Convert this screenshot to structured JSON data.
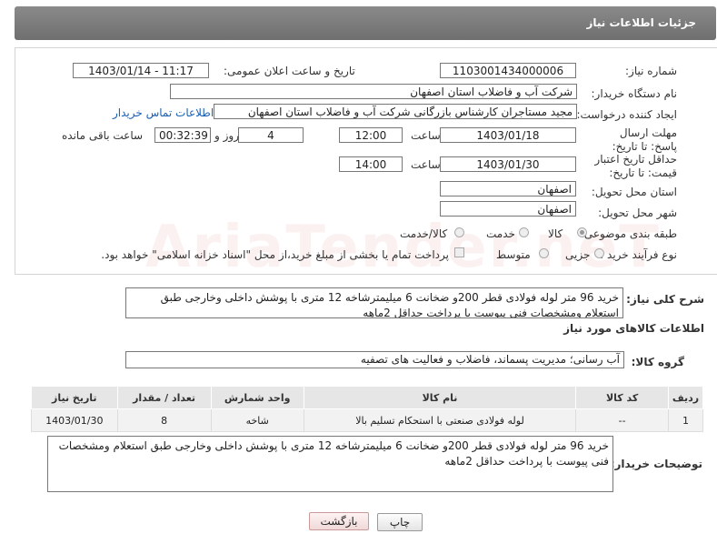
{
  "header": {
    "title": "جزئیات اطلاعات نیاز"
  },
  "form": {
    "need_number_label": "شماره نیاز:",
    "need_number": "1103001434000006",
    "announce_label": "تاریخ و ساعت اعلان عمومی:",
    "announce_value": "1403/01/14 - 11:17",
    "buyer_org_label": "نام دستگاه خریدار:",
    "buyer_org": "شرکت آب و فاضلاب استان اصفهان",
    "creator_label": "ایجاد کننده درخواست:",
    "creator": "مجید مستاجران کارشناس بازرگانی شرکت آب و فاضلاب استان اصفهان",
    "contact_link": "اطلاعات تماس خریدار",
    "deadline_label": "مهلت ارسال پاسخ: تا تاریخ:",
    "deadline_date": "1403/01/18",
    "time_label": "ساعت",
    "deadline_time": "12:00",
    "days_value": "4",
    "days_label": "روز و",
    "remaining_value": "00:32:39",
    "remaining_label": "ساعت باقی مانده",
    "validity_label": "حداقل تاریخ اعتبار قیمت: تا تاریخ:",
    "validity_date": "1403/01/30",
    "validity_time": "14:00",
    "province_label": "استان محل تحویل:",
    "province": "اصفهان",
    "city_label": "شهر محل تحویل:",
    "city": "اصفهان",
    "category_label": "طبقه بندی موضوعی:",
    "category_options": [
      "کالا",
      "خدمت",
      "کالا/خدمت"
    ],
    "category_selected": "کالا",
    "process_label": "نوع فرآیند خرید :",
    "process_options": [
      "جزیی",
      "متوسط"
    ],
    "payment_note": "پرداخت تمام یا بخشی از مبلغ خرید،از محل \"اسناد خزانه اسلامی\" خواهد بود."
  },
  "summary": {
    "label": "شرح کلی نیاز:",
    "text": "خرید 96 متر لوله فولادی قطر 200و ضخانت 6 میلیمترشاخه 12 متری با پوشش داخلی وخارجی طبق استعلام ومشخصات فنی پیوست با پرداخت حداقل 2ماهه"
  },
  "goods": {
    "section_title": "اطلاعات کالاهای مورد نیاز",
    "group_label": "گروه کالا:",
    "group_value": "آب رسانی؛ مدیریت پسماند، فاضلاب و فعالیت های تصفیه",
    "columns": [
      "ردیف",
      "کد کالا",
      "نام کالا",
      "واحد شمارش",
      "تعداد / مقدار",
      "تاریخ نیاز"
    ],
    "rows": [
      {
        "index": "1",
        "code": "--",
        "name": "لوله فولادی صنعتی با استحکام تسلیم بالا",
        "unit": "شاخه",
        "qty": "8",
        "date": "1403/01/30"
      }
    ]
  },
  "buyer_notes": {
    "label": "توضیحات خریدار:",
    "text": "خرید 96 متر لوله فولادی قطر 200و ضخانت 6 میلیمترشاخه 12 متری با پوشش داخلی وخارجی طبق استعلام ومشخصات فنی پیوست با پرداخت حداقل 2ماهه"
  },
  "buttons": {
    "print": "چاپ",
    "back": "بازگشت"
  },
  "watermark": "AriaTender.neT"
}
